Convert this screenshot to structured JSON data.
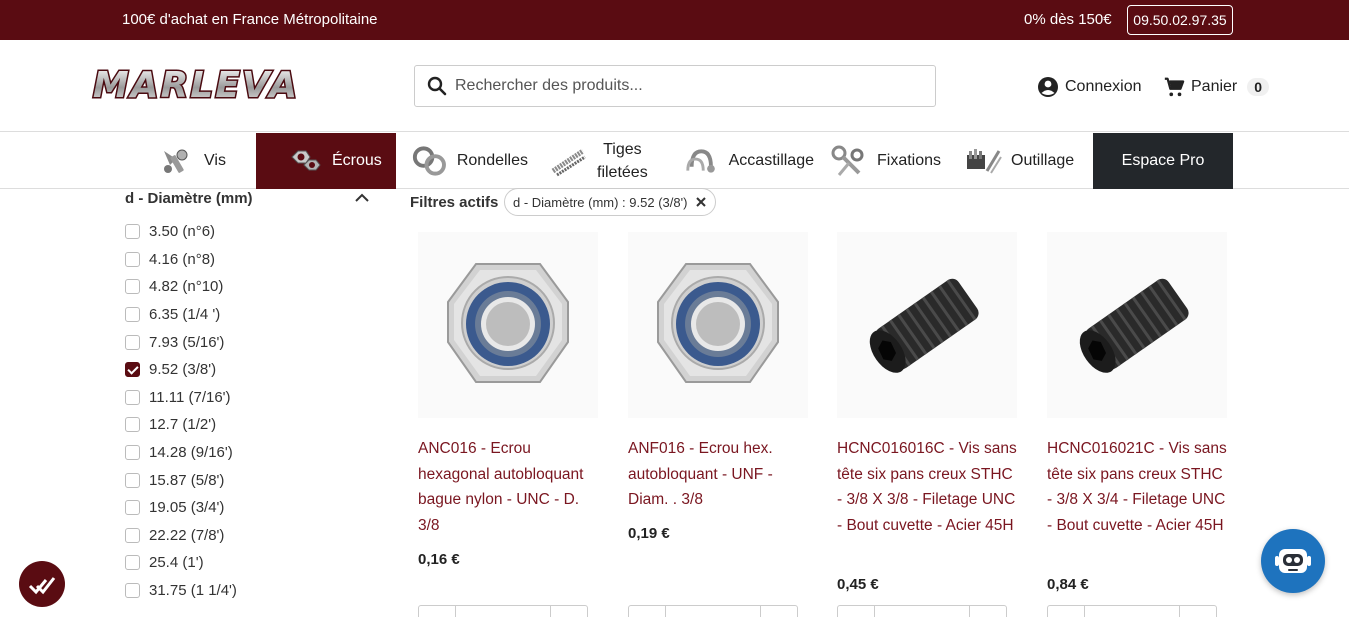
{
  "topbar": {
    "promo": "100€ d'achat en France Métropolitaine",
    "promo_right": "0% dès 150€",
    "phone": "09.50.02.97.35",
    "bg_color": "#5a0c12"
  },
  "header": {
    "logo_text": "MARLEVA",
    "search_placeholder": "Rechercher des produits...",
    "login_label": "Connexion",
    "cart_label": "Panier",
    "cart_count": "0"
  },
  "nav": {
    "items": [
      {
        "label": "Vis",
        "icon": "screws-icon",
        "active": false
      },
      {
        "label": "Écrous",
        "icon": "nuts-icon",
        "active": true
      },
      {
        "label": "Rondelles",
        "icon": "washers-icon",
        "active": false
      },
      {
        "label_line1": "Tiges",
        "label_line2": "filetées",
        "icon": "threaded-rods-icon",
        "active": false
      },
      {
        "label": "Accastillage",
        "icon": "shackles-icon",
        "active": false
      },
      {
        "label": "Fixations",
        "icon": "fixings-icon",
        "active": false
      },
      {
        "label": "Outillage",
        "icon": "tools-icon",
        "active": false
      },
      {
        "label": "Espace Pro",
        "icon": "",
        "active": false
      }
    ],
    "active_color": "#5a0c12",
    "pro_color": "#23272b"
  },
  "sidebar": {
    "facet_title": "d - Diamètre (mm)",
    "options": [
      {
        "label": "3.50 (n°6)",
        "checked": false
      },
      {
        "label": "4.16 (n°8)",
        "checked": false
      },
      {
        "label": "4.82 (n°10)",
        "checked": false
      },
      {
        "label": "6.35 (1/4 ')",
        "checked": false
      },
      {
        "label": "7.93 (5/16')",
        "checked": false
      },
      {
        "label": "9.52 (3/8')",
        "checked": true
      },
      {
        "label": "11.11 (7/16')",
        "checked": false
      },
      {
        "label": "12.7 (1/2')",
        "checked": false
      },
      {
        "label": "14.28 (9/16')",
        "checked": false
      },
      {
        "label": "15.87 (5/8')",
        "checked": false
      },
      {
        "label": "19.05 (3/4')",
        "checked": false
      },
      {
        "label": "22.22 (7/8')",
        "checked": false
      },
      {
        "label": "25.4 (1')",
        "checked": false
      },
      {
        "label": "31.75 (1 1/4')",
        "checked": false
      }
    ]
  },
  "active_filters": {
    "label": "Filtres actifs",
    "chip": "d - Diamètre (mm) : 9.52 (3/8')"
  },
  "products": [
    {
      "name": "ANC016 - Ecrou hexagonal autobloquant bague nylon - UNC - D. 3/8",
      "price": "0,16 €",
      "image": "nylon-lock-nut"
    },
    {
      "name": "ANF016 - Ecrou hex. autobloquant - UNF - Diam. . 3/8",
      "price": "0,19 €",
      "image": "nylon-lock-nut"
    },
    {
      "name": "HCNC016016C - Vis sans tête six pans creux STHC - 3/8 X 3/8 - Filetage UNC - Bout cuvette - Acier 45H",
      "price": "0,45 €",
      "image": "set-screw"
    },
    {
      "name": "HCNC016021C - Vis sans tête six pans creux STHC - 3/8 X 3/4 - Filetage UNC - Bout cuvette - Acier 45H",
      "price": "0,84 €",
      "image": "set-screw"
    }
  ]
}
